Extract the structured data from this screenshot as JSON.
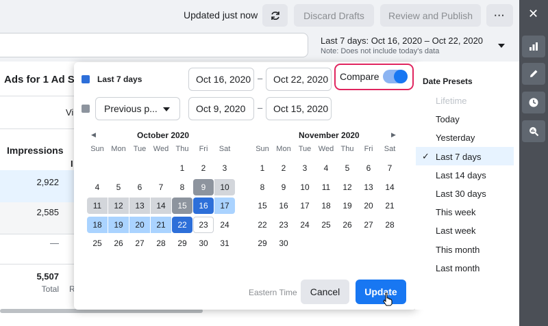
{
  "topbar": {
    "updated_text": "Updated just now",
    "discard_label": "Discard Drafts",
    "review_label": "Review and Publish",
    "more_label": "···"
  },
  "date_range": {
    "label": "Last 7 days: Oct 16, 2020 – Oct 22, 2020",
    "note": "Note: Does not include today's data"
  },
  "table": {
    "title": "Ads for 1 Ad Se",
    "col_impressions": "Impressions",
    "rows": [
      "2,922",
      "2,585",
      "—"
    ],
    "total_value": "5,507",
    "total_label": "Total",
    "partial_vi": "Vi",
    "partial_i": "I",
    "partial_r": "R"
  },
  "popup": {
    "primary_label": "Last 7 days",
    "primary_color": "#2d6fd9",
    "compare_color": "#8d949e",
    "start_date": "Oct 16, 2020",
    "end_date": "Oct 22, 2020",
    "compare_select": "Previous p...",
    "compare_start": "Oct 9, 2020",
    "compare_end": "Oct 15, 2020",
    "dash": "–",
    "compare_label": "Compare",
    "compare_on": true,
    "timezone": "Eastern Time",
    "cancel_label": "Cancel",
    "update_label": "Update",
    "weekdays": [
      "Sun",
      "Mon",
      "Tue",
      "Wed",
      "Thu",
      "Fri",
      "Sat"
    ],
    "months": [
      {
        "title": "October 2020",
        "first_weekday": 4,
        "days": 31
      },
      {
        "title": "November 2020",
        "first_weekday": 0,
        "days": 30
      }
    ]
  },
  "presets": {
    "heading": "Date Presets",
    "items": [
      "Lifetime",
      "Today",
      "Yesterday",
      "Last 7 days",
      "Last 14 days",
      "Last 30 days",
      "This week",
      "Last week",
      "This month",
      "Last month"
    ],
    "selected": "Last 7 days",
    "disabled": "Lifetime"
  },
  "rail": {
    "icons": [
      "close-icon",
      "bar-chart-icon",
      "pencil-icon",
      "clock-icon",
      "search-chart-icon"
    ]
  }
}
